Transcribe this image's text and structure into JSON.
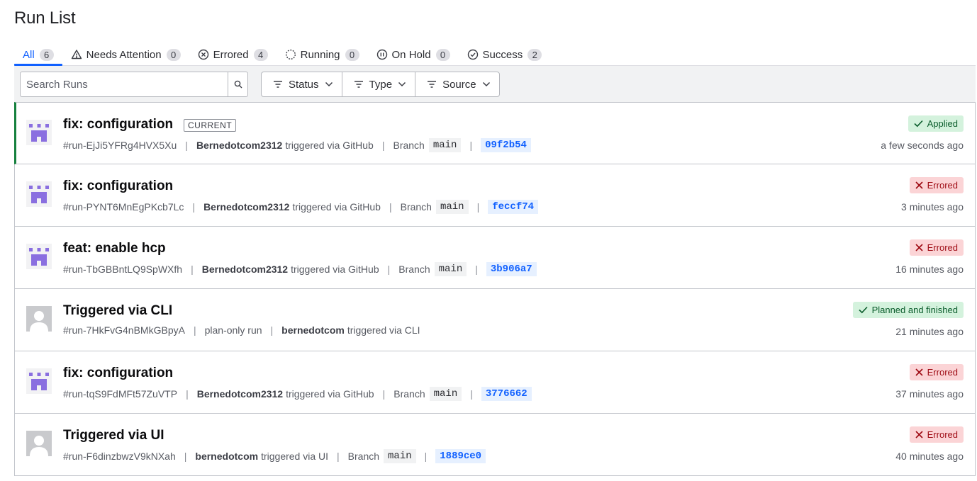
{
  "page": {
    "title": "Run List"
  },
  "tabs": [
    {
      "label": "All",
      "count": "6",
      "icon": "none"
    },
    {
      "label": "Needs Attention",
      "count": "0",
      "icon": "warning-triangle-icon"
    },
    {
      "label": "Errored",
      "count": "4",
      "icon": "x-circle-icon"
    },
    {
      "label": "Running",
      "count": "0",
      "icon": "loading-icon"
    },
    {
      "label": "On Hold",
      "count": "0",
      "icon": "pause-circle-icon"
    },
    {
      "label": "Success",
      "count": "2",
      "icon": "check-circle-icon"
    }
  ],
  "search": {
    "placeholder": "Search Runs"
  },
  "filters": [
    {
      "label": "Status"
    },
    {
      "label": "Type"
    },
    {
      "label": "Source"
    }
  ],
  "runs": [
    {
      "title": "fix: configuration",
      "badge": "CURRENT",
      "id": "#run-EjJi5YFRg4HVX5Xu",
      "user": "Bernedotcom2312",
      "trigger": "triggered via GitHub",
      "branch_label": "Branch",
      "branch": "main",
      "sha": "09f2b54",
      "status": "Applied",
      "time": "a few seconds ago",
      "avatar": "vcs"
    },
    {
      "title": "fix: configuration",
      "id": "#run-PYNT6MnEgPKcb7Lc",
      "user": "Bernedotcom2312",
      "trigger": "triggered via GitHub",
      "branch_label": "Branch",
      "branch": "main",
      "sha": "feccf74",
      "status": "Errored",
      "time": "3 minutes ago",
      "avatar": "vcs"
    },
    {
      "title": "feat: enable hcp",
      "id": "#run-TbGBBntLQ9SpWXfh",
      "user": "Bernedotcom2312",
      "trigger": "triggered via GitHub",
      "branch_label": "Branch",
      "branch": "main",
      "sha": "3b906a7",
      "status": "Errored",
      "time": "16 minutes ago",
      "avatar": "vcs"
    },
    {
      "title": "Triggered via CLI",
      "id": "#run-7HkFvG4nBMkGBpyA",
      "plan": "plan-only run",
      "user": "bernedotcom",
      "trigger": "triggered via CLI",
      "status": "Planned and finished",
      "time": "21 minutes ago",
      "avatar": "user"
    },
    {
      "title": "fix: configuration",
      "id": "#run-tqS9FdMFt57ZuVTP",
      "user": "Bernedotcom2312",
      "trigger": "triggered via GitHub",
      "branch_label": "Branch",
      "branch": "main",
      "sha": "3776662",
      "status": "Errored",
      "time": "37 minutes ago",
      "avatar": "vcs"
    },
    {
      "title": "Triggered via UI",
      "id": "#run-F6dinzbwzV9kNXah",
      "user": "bernedotcom",
      "trigger": "triggered via UI",
      "branch_label": "Branch",
      "branch": "main",
      "sha": "1889ce0",
      "status": "Errored",
      "time": "40 minutes ago",
      "avatar": "user"
    }
  ],
  "colors": {
    "accent": "#1060ff",
    "success": "#15803d",
    "error": "#9e0a13",
    "avatar_vcs": "#8a6fe0"
  }
}
